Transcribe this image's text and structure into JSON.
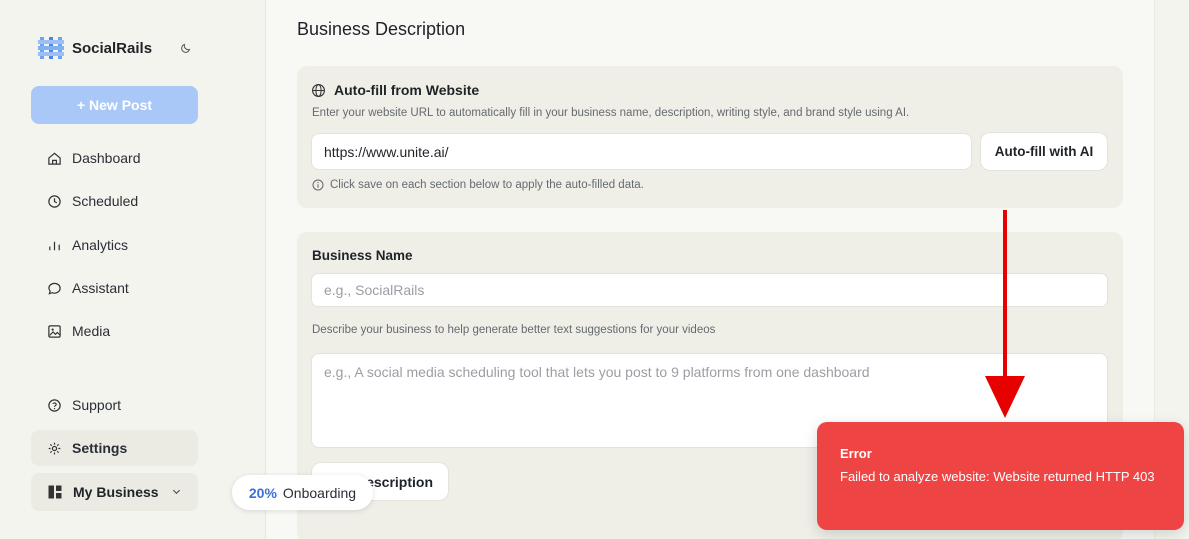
{
  "sidebar": {
    "brand": "SocialRails",
    "new_post": "+ New Post",
    "nav": {
      "dashboard": "Dashboard",
      "scheduled": "Scheduled",
      "analytics": "Analytics",
      "assistant": "Assistant",
      "media": "Media",
      "support": "Support",
      "settings": "Settings"
    },
    "my_business": "My Business"
  },
  "main": {
    "page_title": "Business Description",
    "autofill": {
      "title": "Auto-fill from Website",
      "description": "Enter your website URL to automatically fill in your business name, description, writing style, and brand style using AI.",
      "url_value": "https://www.unite.ai/",
      "button": "Auto-fill with AI",
      "hint": "Click save on each section below to apply the auto-filled data."
    },
    "business": {
      "name_label": "Business Name",
      "name_placeholder": "e.g., SocialRails",
      "desc_label": "Describe your business to help generate better text suggestions for your videos",
      "desc_placeholder": "e.g., A social media scheduling tool that lets you post to 9 platforms from one dashboard",
      "save_button": "Description"
    }
  },
  "onboarding": {
    "percent": "20%",
    "label": "Onboarding"
  },
  "toast": {
    "title": "Error",
    "message": "Failed to analyze website: Website returned HTTP 403"
  },
  "colors": {
    "accent": "#a9c8f8",
    "error": "#ef4444",
    "arrow": "#e60000"
  }
}
